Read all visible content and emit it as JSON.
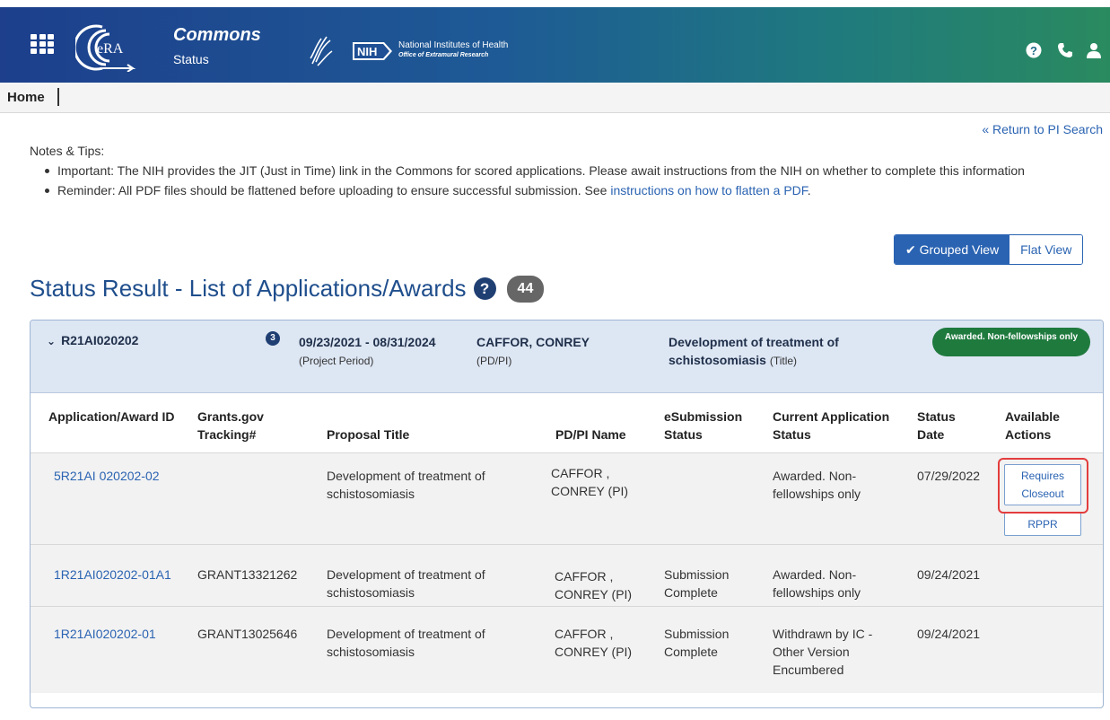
{
  "header": {
    "app_title": "Commons",
    "app_subtitle": "Status",
    "era_logo_text": "eRA",
    "nih_badge": "NIH",
    "nih_name": "National Institutes of Health",
    "nih_office": "Office of Extramural Research",
    "icons": [
      "apps-grid-icon",
      "help-icon",
      "phone-icon",
      "user-icon"
    ],
    "gradient_colors": [
      "#1d3f8c",
      "#1f7a7e",
      "#2a8a5f"
    ]
  },
  "nav": {
    "home": "Home"
  },
  "return_link": "« Return to PI Search",
  "notes": {
    "heading": "Notes & Tips:",
    "important": "Important: The NIH provides the JIT (Just in Time) link in the Commons for scored applications. Please await instructions from the NIH on whether to complete this information",
    "reminder_prefix": "Reminder: All PDF files should be flattened before uploading to ensure successful submission. See ",
    "reminder_link": "instructions on how to flatten a PDF",
    "reminder_suffix": "."
  },
  "view_toggle": {
    "grouped": "✔ Grouped View",
    "flat": "Flat View",
    "selected": "grouped"
  },
  "page_title": "Status Result - List of Applications/Awards",
  "result_count": "44",
  "group": {
    "id": "R21AI020202",
    "count": "3",
    "period_dates": "09/23/2021 - 08/31/2024",
    "period_label": "(Project Period)",
    "pi_name": "CAFFOR, CONREY",
    "pi_label": "(PD/PI)",
    "title": "Development of treatment of schistosomiasis",
    "title_label": "(Title)",
    "status": "Awarded. Non-fellowships only",
    "status_color": "#1f7a3e"
  },
  "columns": [
    "Application/Award ID",
    "Grants.gov Tracking#",
    "Proposal Title",
    "PD/PI Name",
    "eSubmission Status",
    "Current Application Status",
    "Status Date",
    "Available Actions"
  ],
  "rows": [
    {
      "app_id": "5R21AI 020202-02",
      "tracking": "",
      "title": "Development of treatment of schistosomiasis",
      "pi": "CAFFOR , CONREY (PI)",
      "esub": "",
      "status": "Awarded. Non-fellowships only",
      "date": "07/29/2022",
      "actions": [
        "Requires Closeout",
        "RPPR"
      ]
    },
    {
      "app_id": "1R21AI020202-01A1",
      "tracking": "GRANT13321262",
      "title": "Development of treatment of schistosomiasis",
      "pi": "CAFFOR , CONREY (PI)",
      "esub": "Submission Complete",
      "status": "Awarded. Non-fellowships only",
      "date": "09/24/2021",
      "actions": []
    },
    {
      "app_id": "1R21AI020202-01",
      "tracking": "GRANT13025646",
      "title": "Development of treatment of schistosomiasis",
      "pi": "CAFFOR , CONREY (PI)",
      "esub": "Submission Complete",
      "status": "Withdrawn by IC - Other Version Encumbered",
      "date": "09/24/2021",
      "actions": []
    }
  ],
  "highlight_color": "#e33d3d"
}
